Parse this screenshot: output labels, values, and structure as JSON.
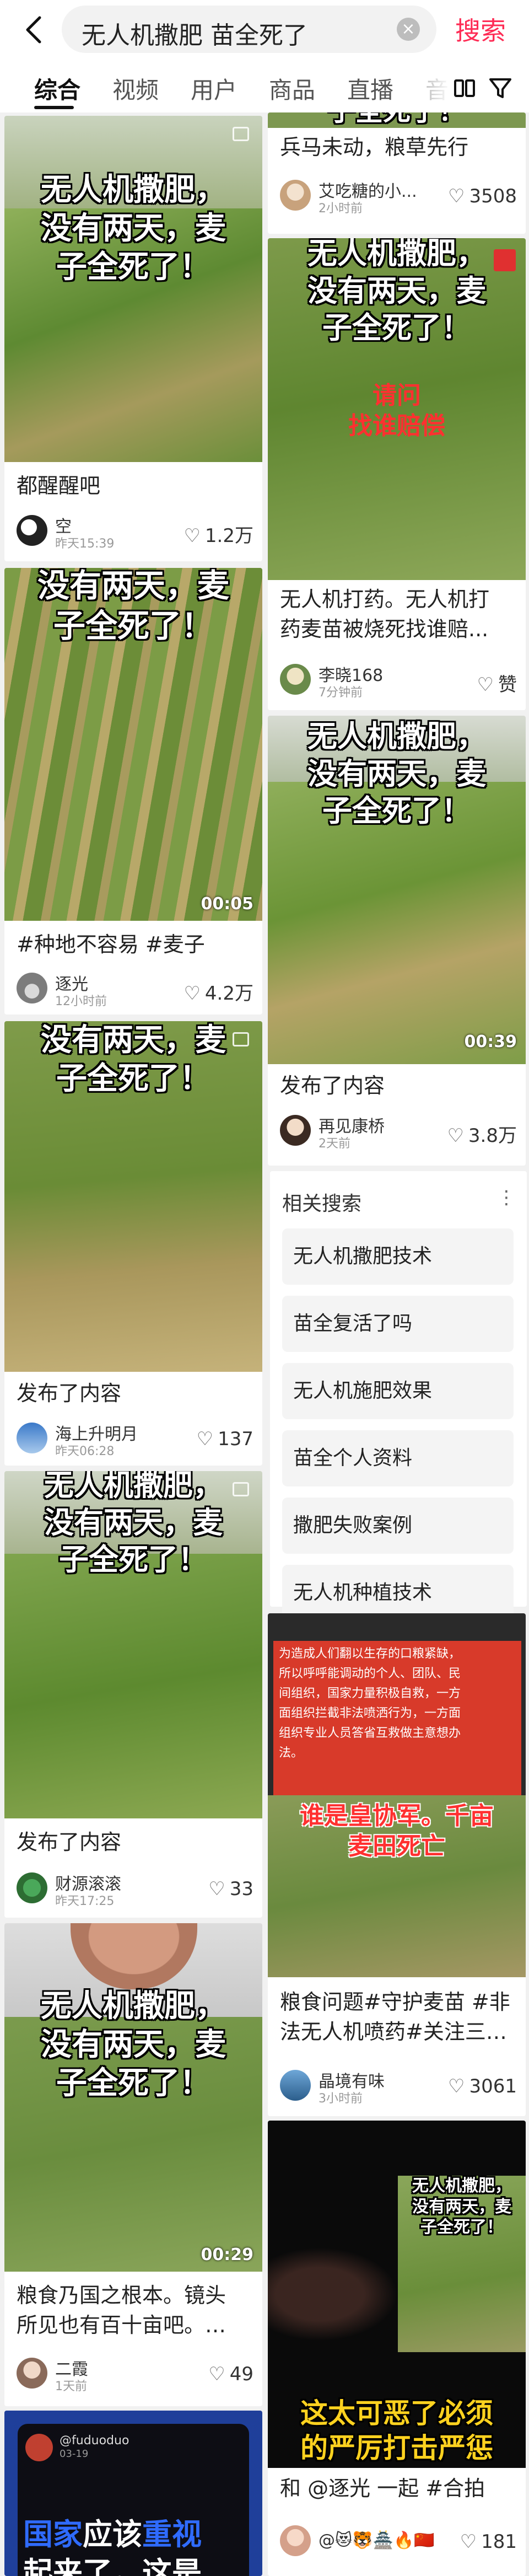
{
  "search": {
    "query": "无人机撒肥 苗全死了",
    "clear_label": "×",
    "submit_label": "搜索"
  },
  "tabs": [
    {
      "label": "综合",
      "active": true
    },
    {
      "label": "视频"
    },
    {
      "label": "用户"
    },
    {
      "label": "商品"
    },
    {
      "label": "直播"
    },
    {
      "label": "音"
    }
  ],
  "tab_icons": [
    "grid-view-icon",
    "filter-icon"
  ],
  "left_column": [
    {
      "overlay": [
        "无人机撒肥，",
        "没有两天，麦",
        "子全死了！"
      ],
      "title": "都醒醒吧",
      "author": "空",
      "time": "昨天15:39",
      "likes": "1.2万"
    },
    {
      "overlay": [
        "没有两天，麦",
        "子全死了！"
      ],
      "duration": "00:05",
      "title": "#种地不容易 #麦子",
      "author": "逐光",
      "time": "12小时前",
      "likes": "4.2万"
    },
    {
      "overlay": [
        "没有两天，麦",
        "子全死了！"
      ],
      "title": "发布了内容",
      "author": "海上升明月",
      "time": "昨天06:28",
      "likes": "137"
    },
    {
      "overlay": [
        "无人机撒肥，",
        "没有两天，麦",
        "子全死了！"
      ],
      "title": "发布了内容",
      "author": "财源滚滚",
      "time": "昨天17:25",
      "likes": "33"
    },
    {
      "overlay": [
        "无人机撒肥，",
        "没有两天，麦",
        "子全死了！"
      ],
      "duration": "00:29",
      "title_lines": [
        "粮食乃国之根本。镜头",
        "所见也有百十亩吧。…"
      ],
      "author": "二霞",
      "time": "1天前",
      "likes": "49"
    },
    {
      "handle": "@fuduoduo",
      "handle_date": "03-19",
      "overlay_colored": [
        {
          "text": "国家",
          "color": "#2f6bff"
        },
        {
          "text": "应该",
          "color": "#ffffff"
        },
        {
          "text": "重视",
          "color": "#2f6bff"
        }
      ],
      "overlay_line2": "起来了，这是"
    }
  ],
  "right_column": [
    {
      "overlay_partial": "子全死了！",
      "title": "兵马未动，粮草先行",
      "author": "艾吃糖的小...",
      "time": "2小时前",
      "likes": "3508"
    },
    {
      "overlay": [
        "无人机撒肥，",
        "没有两天，麦",
        "子全死了！"
      ],
      "overlay_red": [
        "请问",
        "找谁赔偿"
      ],
      "title_lines": [
        "无人机打药。无人机打",
        "药麦苗被烧死找谁赔..."
      ],
      "author": "李晓168",
      "time": "7分钟前",
      "likes": "赞"
    },
    {
      "overlay": [
        "无人机撒肥，",
        "没有两天，麦",
        "子全死了！"
      ],
      "duration": "00:39",
      "title": "发布了内容",
      "author": "再见康桥",
      "time": "2天前",
      "likes": "3.8万"
    },
    {
      "text_block": [
        "为造成人们翻以生存的口粮紧缺，",
        "所以呼呼能调动的个人、团队、民",
        "间组织，国家力量积极自救，一方",
        "面组织拦截非法喷洒行为，一方面",
        "组织专业人员答省互救做主意想办",
        "法。"
      ],
      "overlay_red": [
        "谁是皇协军。千亩",
        "麦田死亡"
      ],
      "title_lines": [
        "粮食问题#守护麦苗 #非",
        "法无人机喷药#关注三…"
      ],
      "author": "晶境有味",
      "time": "3小时前",
      "likes": "3061"
    },
    {
      "overlay": [
        "无人机撒肥，",
        "没有两天，麦",
        "子全死了！"
      ],
      "overlay_big": [
        "这太可恶了必须",
        "的严厉打击严惩"
      ],
      "title": "和 @逐光 一起 #合拍",
      "author": "@😻🐯🏯🔥🇨🇳",
      "likes": "181"
    }
  ],
  "related": {
    "title": "相关搜索",
    "more_label": "⋮",
    "items": [
      "无人机撒肥技术",
      "苗全复活了吗",
      "无人机施肥效果",
      "苗全个人资料",
      "撒肥失败案例",
      "无人机种植技术"
    ]
  },
  "colors": {
    "accent": "#fe2c55",
    "wheat_green": "#6f9a3a",
    "dead_straw": "#b9a56a"
  }
}
